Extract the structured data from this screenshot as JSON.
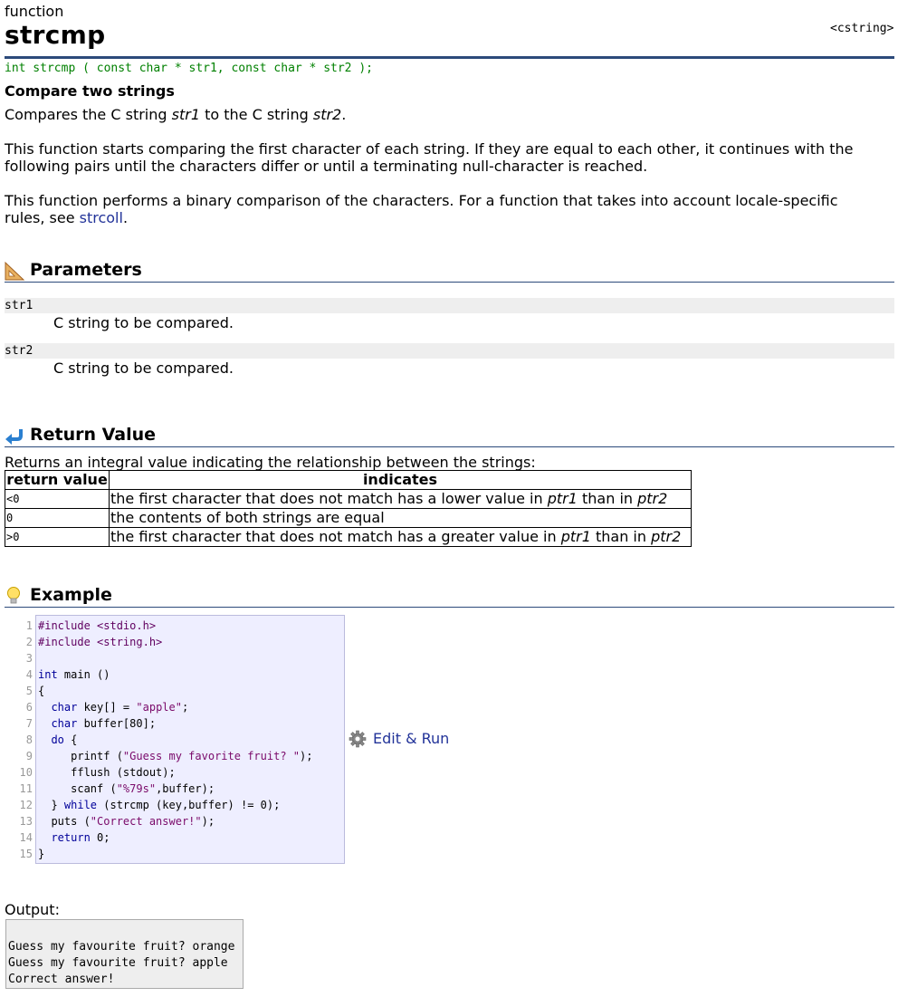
{
  "page": {
    "kind": "function",
    "name": "strcmp",
    "header": "<cstring>",
    "prototype": "int strcmp ( const char * str1, const char * str2 );",
    "summary": "Compare two strings"
  },
  "description": {
    "p1_a": "Compares the C string ",
    "p1_str1": "str1",
    "p1_b": " to the C string ",
    "p1_str2": "str2",
    "p1_c": ".",
    "p2": "This function starts comparing the first character of each string. If they are equal to each other, it continues with the following pairs until the characters differ or until a terminating null-character is reached.",
    "p3_a": "This function performs a binary comparison of the characters. For a function that takes into account locale-specific rules, see ",
    "p3_link": "strcoll",
    "p3_b": "."
  },
  "parameters": {
    "title": "Parameters",
    "items": [
      {
        "name": "str1",
        "desc": "C string to be compared."
      },
      {
        "name": "str2",
        "desc": "C string to be compared."
      }
    ]
  },
  "return_value": {
    "title": "Return Value",
    "intro": "Returns an integral value indicating the relationship between the strings:",
    "columns": [
      "return value",
      "indicates"
    ],
    "rows": [
      {
        "value": "<0",
        "a": "the first character that does not match has a lower value in ",
        "p1": "ptr1",
        "b": " than in ",
        "p2": "ptr2"
      },
      {
        "value": "0",
        "a": "the contents of both strings are equal"
      },
      {
        "value": ">0",
        "a": "the first character that does not match has a greater value in ",
        "p1": "ptr1",
        "b": " than in ",
        "p2": "ptr2"
      }
    ]
  },
  "example": {
    "title": "Example",
    "line_numbers": [
      "1",
      "2",
      "3",
      "4",
      "5",
      "6",
      "7",
      "8",
      "9",
      "10",
      "11",
      "12",
      "13",
      "14",
      "15"
    ],
    "code_lines": [
      "#include <stdio.h>",
      "#include <string.h>",
      "",
      "int main ()",
      "{",
      "  char key[] = \"apple\";",
      "  char buffer[80];",
      "  do {",
      "     printf (\"Guess my favorite fruit? \");",
      "     fflush (stdout);",
      "     scanf (\"%79s\",buffer);",
      "  } while (strcmp (key,buffer) != 0);",
      "  puts (\"Correct answer!\");",
      "  return 0;",
      "}"
    ],
    "edit_run_label": "Edit & Run",
    "output_label": "Output:",
    "output_lines": [
      "Guess my favourite fruit? orange",
      "Guess my favourite fruit? apple",
      "Correct answer!"
    ]
  },
  "colors": {
    "rule": "#2c4a7a",
    "link": "#223399",
    "prototype": "#008000",
    "code_bg": "#eeeeff"
  },
  "icons": {
    "parameters": "set-square-icon",
    "return": "return-arrow-icon",
    "example": "lightbulb-icon",
    "edit_run": "gear-icon"
  }
}
